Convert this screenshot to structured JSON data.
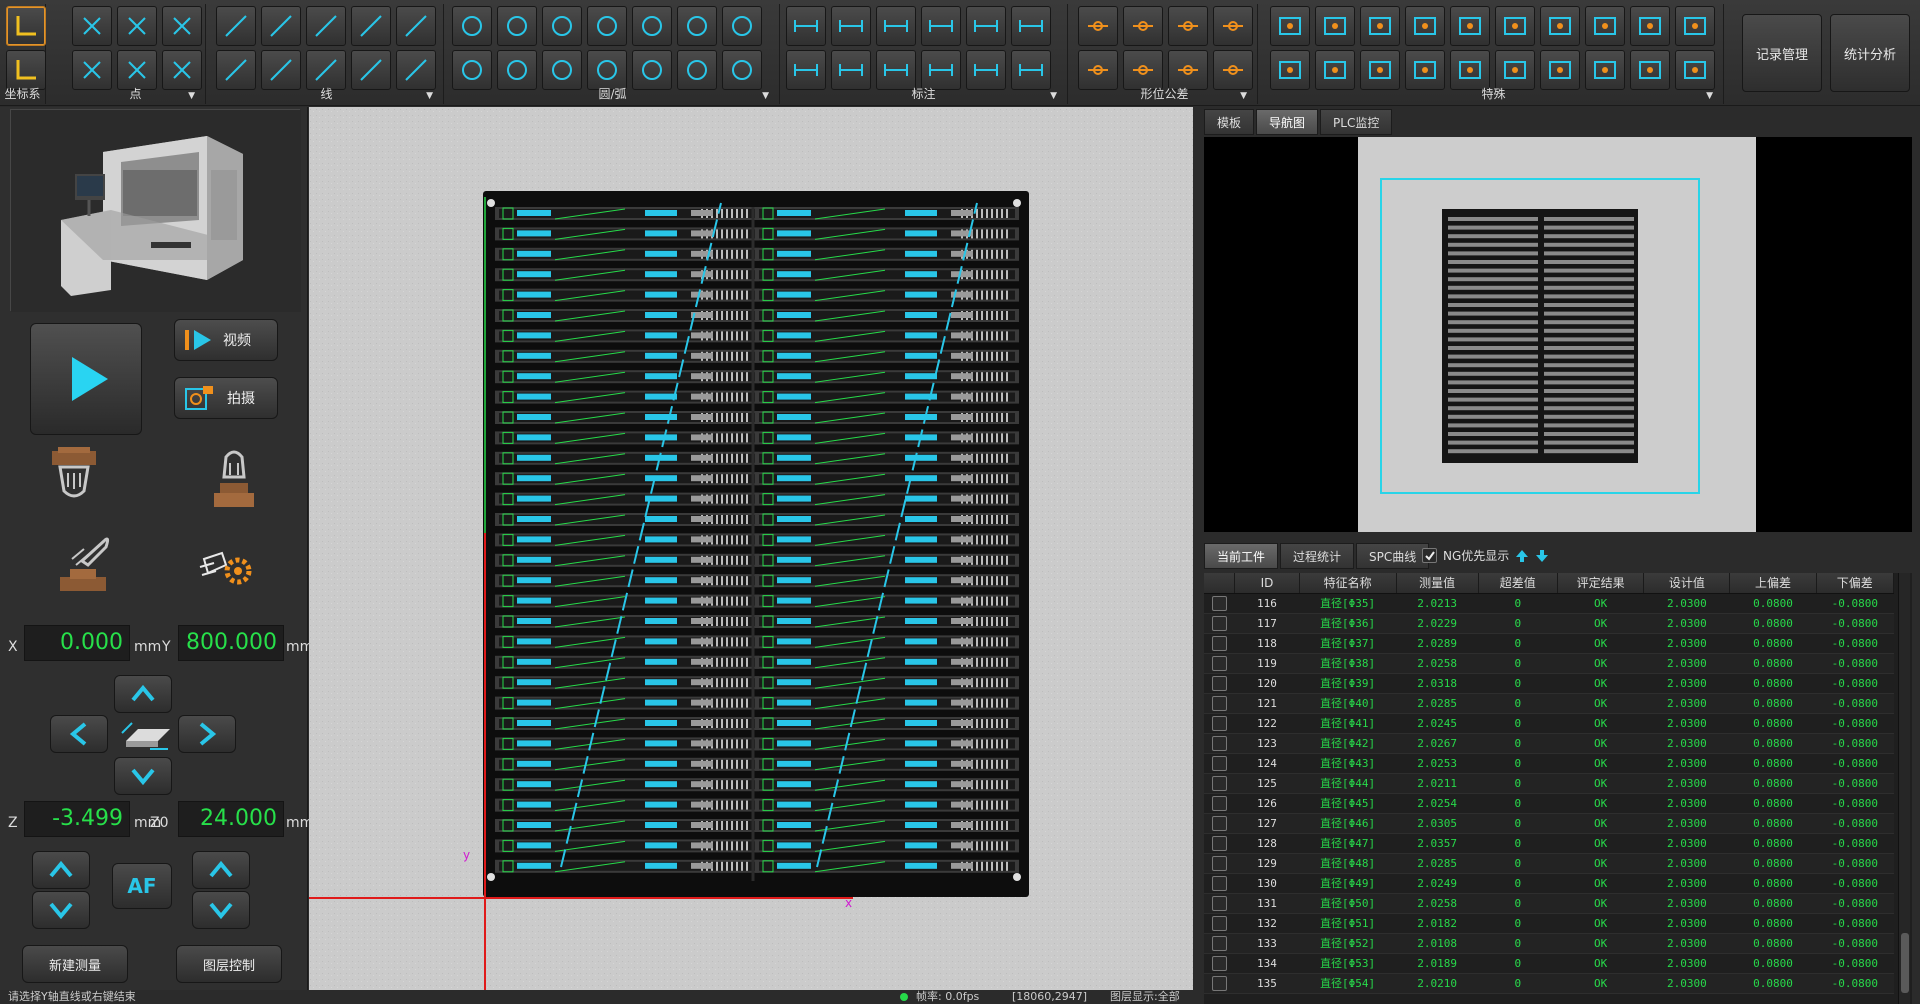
{
  "ribbon": {
    "groups": [
      {
        "label": "坐标系",
        "icons": [
          "coord-system-icon",
          "coord-origin-icon"
        ]
      },
      {
        "label": "点",
        "icons": [
          "cross-point-icon",
          "hatch-point-icon",
          "wave-point-icon",
          "mid-point-icon",
          "line-point-icon",
          "arc-point-icon"
        ]
      },
      {
        "label": "线",
        "icons": [
          "line-icon",
          "dotted-line-icon",
          "long-line-icon",
          "box-line-icon",
          "slant-line-icon",
          "parallel-line-icon",
          "angle-line-icon",
          "bisector-line-icon",
          "dashed-line-icon",
          "diag-line-icon"
        ]
      },
      {
        "label": "圆/弧",
        "icons": [
          "circle-icon",
          "arc-circle-icon",
          "square-circle-icon",
          "center-circle-icon",
          "gear-circle-icon",
          "half-circle-icon",
          "pin-circle-icon",
          "curve-arc-icon",
          "three-point-arc-icon",
          "polygon-circle-icon",
          "tangent-arc-icon",
          "wave-arc-icon",
          "rounded-circle-icon",
          "ellipse-icon"
        ]
      },
      {
        "label": "标注",
        "icons": [
          "hline-dim-icon",
          "parallel-dim-icon",
          "angle-dim-icon",
          "width-dim-icon",
          "height-dim-icon",
          "baseline-dim-icon",
          "radius-dim-icon",
          "diameter-dim-icon",
          "angle-deg-dim-icon",
          "triangle-dim-icon",
          "mm-dim-icon",
          "hatch-dim-icon"
        ]
      },
      {
        "label": "形位公差",
        "icons": [
          "straightness-icon",
          "circularity-icon",
          "concentric-icon",
          "symmetry-icon",
          "position-icon",
          "parallelism-icon",
          "perpendicular-icon",
          "profile-icon"
        ]
      },
      {
        "label": "特殊",
        "icons": [
          "edge-special-icon",
          "target-special-icon",
          "grid-special-icon",
          "network-special-icon",
          "table-special-icon",
          "tree-special-icon",
          "arrow-special-icon",
          "radar-special-icon",
          "crosshair-special-icon",
          "toggle-special-icon",
          "branch-special-icon",
          "comb-special-icon",
          "gear-special-icon",
          "compass-special-icon",
          "peaks-special-icon",
          "scatter-special-icon",
          "frame-special-icon",
          "matrix-special-icon",
          "center-special-icon",
          "bracket-special-icon"
        ]
      }
    ],
    "record_btn": "记录管理",
    "stats_btn": "统计分析"
  },
  "controls": {
    "video_label": "视频",
    "capture_label": "拍摄",
    "x_label": "X",
    "x_value": "0.000",
    "y_label": "Y",
    "y_value": "800.000",
    "z_label": "Z",
    "z_value": "-3.499",
    "z0_label": "Z0",
    "z0_value": "24.000",
    "unit": "mm",
    "af_label": "AF",
    "new_measure": "新建测量",
    "layer_control": "图层控制"
  },
  "right": {
    "top_tabs": [
      "模板",
      "导航图",
      "PLC监控"
    ],
    "bottom_tabs": [
      "当前工件",
      "过程统计",
      "SPC曲线"
    ],
    "ng_label": "NG优先显示",
    "columns": [
      "ID",
      "特征名称",
      "测量值",
      "超差值",
      "评定结果",
      "设计值",
      "上偏差",
      "下偏差"
    ],
    "rows": [
      [
        "116",
        "直径[Φ35]",
        "2.0213",
        "0",
        "OK",
        "2.0300",
        "0.0800",
        "-0.0800"
      ],
      [
        "117",
        "直径[Φ36]",
        "2.0229",
        "0",
        "OK",
        "2.0300",
        "0.0800",
        "-0.0800"
      ],
      [
        "118",
        "直径[Φ37]",
        "2.0289",
        "0",
        "OK",
        "2.0300",
        "0.0800",
        "-0.0800"
      ],
      [
        "119",
        "直径[Φ38]",
        "2.0258",
        "0",
        "OK",
        "2.0300",
        "0.0800",
        "-0.0800"
      ],
      [
        "120",
        "直径[Φ39]",
        "2.0318",
        "0",
        "OK",
        "2.0300",
        "0.0800",
        "-0.0800"
      ],
      [
        "121",
        "直径[Φ40]",
        "2.0285",
        "0",
        "OK",
        "2.0300",
        "0.0800",
        "-0.0800"
      ],
      [
        "122",
        "直径[Φ41]",
        "2.0245",
        "0",
        "OK",
        "2.0300",
        "0.0800",
        "-0.0800"
      ],
      [
        "123",
        "直径[Φ42]",
        "2.0267",
        "0",
        "OK",
        "2.0300",
        "0.0800",
        "-0.0800"
      ],
      [
        "124",
        "直径[Φ43]",
        "2.0253",
        "0",
        "OK",
        "2.0300",
        "0.0800",
        "-0.0800"
      ],
      [
        "125",
        "直径[Φ44]",
        "2.0211",
        "0",
        "OK",
        "2.0300",
        "0.0800",
        "-0.0800"
      ],
      [
        "126",
        "直径[Φ45]",
        "2.0254",
        "0",
        "OK",
        "2.0300",
        "0.0800",
        "-0.0800"
      ],
      [
        "127",
        "直径[Φ46]",
        "2.0305",
        "0",
        "OK",
        "2.0300",
        "0.0800",
        "-0.0800"
      ],
      [
        "128",
        "直径[Φ47]",
        "2.0357",
        "0",
        "OK",
        "2.0300",
        "0.0800",
        "-0.0800"
      ],
      [
        "129",
        "直径[Φ48]",
        "2.0285",
        "0",
        "OK",
        "2.0300",
        "0.0800",
        "-0.0800"
      ],
      [
        "130",
        "直径[Φ49]",
        "2.0249",
        "0",
        "OK",
        "2.0300",
        "0.0800",
        "-0.0800"
      ],
      [
        "131",
        "直径[Φ50]",
        "2.0258",
        "0",
        "OK",
        "2.0300",
        "0.0800",
        "-0.0800"
      ],
      [
        "132",
        "直径[Φ51]",
        "2.0182",
        "0",
        "OK",
        "2.0300",
        "0.0800",
        "-0.0800"
      ],
      [
        "133",
        "直径[Φ52]",
        "2.0108",
        "0",
        "OK",
        "2.0300",
        "0.0800",
        "-0.0800"
      ],
      [
        "134",
        "直径[Φ53]",
        "2.0189",
        "0",
        "OK",
        "2.0300",
        "0.0800",
        "-0.0800"
      ],
      [
        "135",
        "直径[Φ54]",
        "2.0210",
        "0",
        "OK",
        "2.0300",
        "0.0800",
        "-0.0800"
      ]
    ]
  },
  "status": {
    "message": "请选择Y轴直线或右键结束",
    "fps": "帧率: 0.0fps",
    "coords": "[18060,2947]",
    "layer": "图层显示:全部"
  },
  "colors": {
    "accent": "#29c6e8",
    "ok_green": "#27d94a",
    "coord_green": "#27e04a",
    "selected_orange": "#e3952b"
  }
}
